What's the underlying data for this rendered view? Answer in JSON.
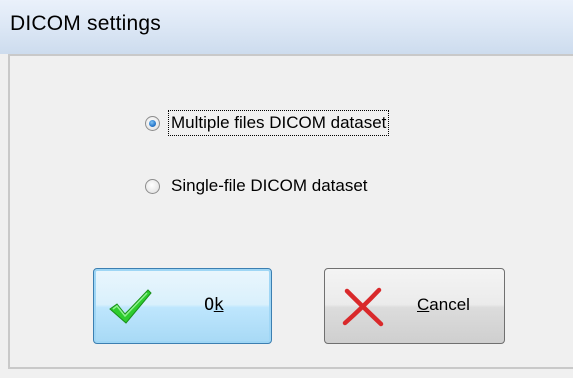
{
  "window": {
    "title": "DICOM settings"
  },
  "options": [
    {
      "label": "Multiple files DICOM dataset",
      "selected": true,
      "focused": true
    },
    {
      "label": "Single-file DICOM dataset",
      "selected": false,
      "focused": false
    }
  ],
  "buttons": {
    "ok": {
      "label_pre": "O",
      "label_accel": "k",
      "label_post": "",
      "icon": "checkmark-icon",
      "color": "#2ecc2e"
    },
    "cancel": {
      "label_pre": "",
      "label_accel": "C",
      "label_post": "ancel",
      "icon": "cross-icon",
      "color": "#d9292b"
    }
  },
  "colors": {
    "titlebar": "#dce7f5",
    "radio_selected": "#2f7fd0",
    "default_button_border": "#3c7fb1"
  }
}
